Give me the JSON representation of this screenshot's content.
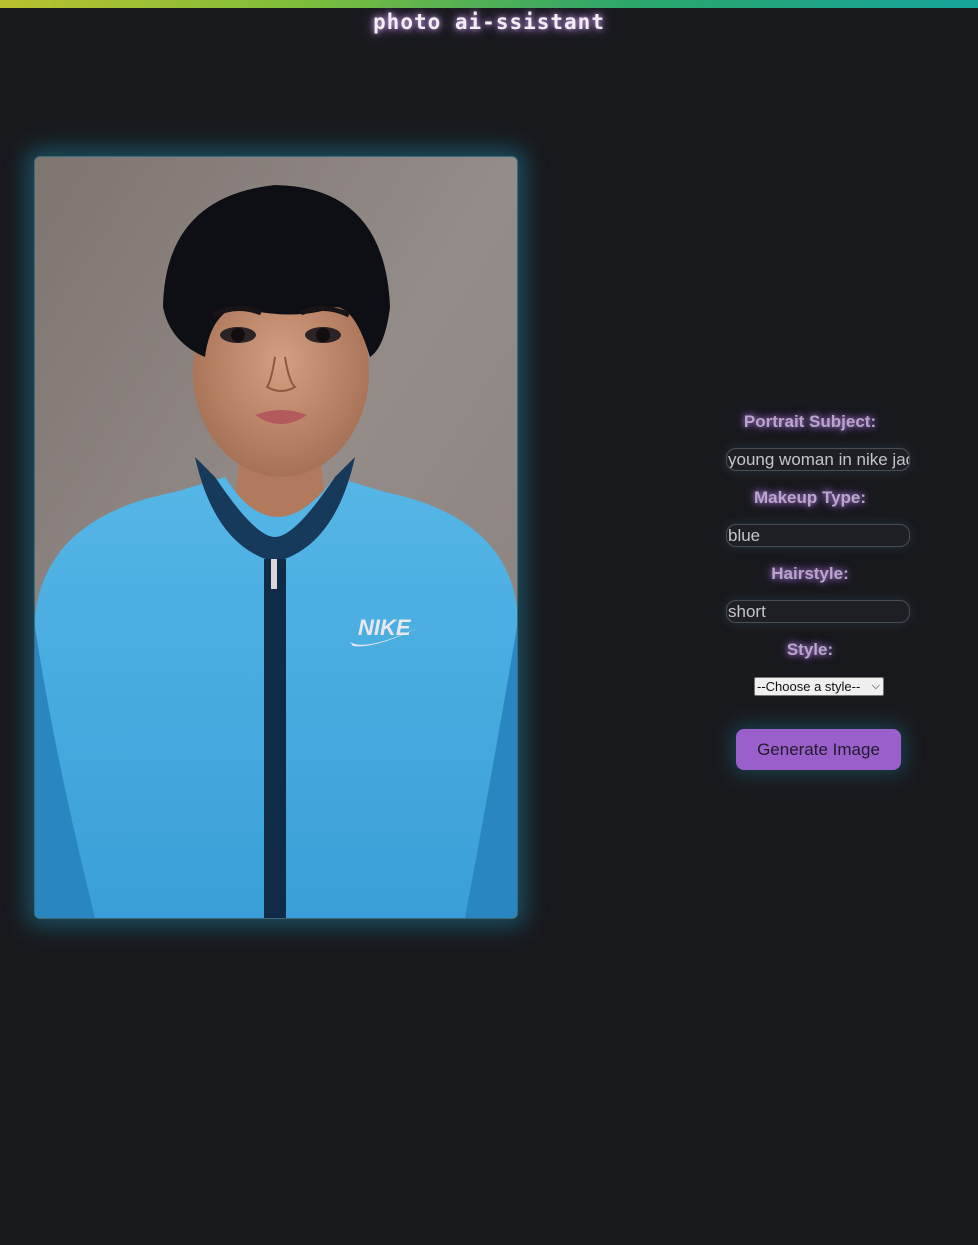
{
  "app": {
    "title": "photo ai-ssistant"
  },
  "image": {
    "icon": "portrait-photo",
    "logo_text": "NIKE"
  },
  "form": {
    "portrait_subject_label": "Portrait Subject:",
    "portrait_subject_value": "young woman in nike jacke",
    "makeup_type_label": "Makeup Type:",
    "makeup_type_value": "blue",
    "hairstyle_label": "Hairstyle:",
    "hairstyle_value": "short",
    "style_label": "Style:",
    "style_selected": "--Choose a style--",
    "generate_button": "Generate Image"
  },
  "colors": {
    "background": "#18191d",
    "accent_glow": "#9b5fcb",
    "button": "#9b5fcb",
    "frame_glow": "#1e8caa"
  }
}
